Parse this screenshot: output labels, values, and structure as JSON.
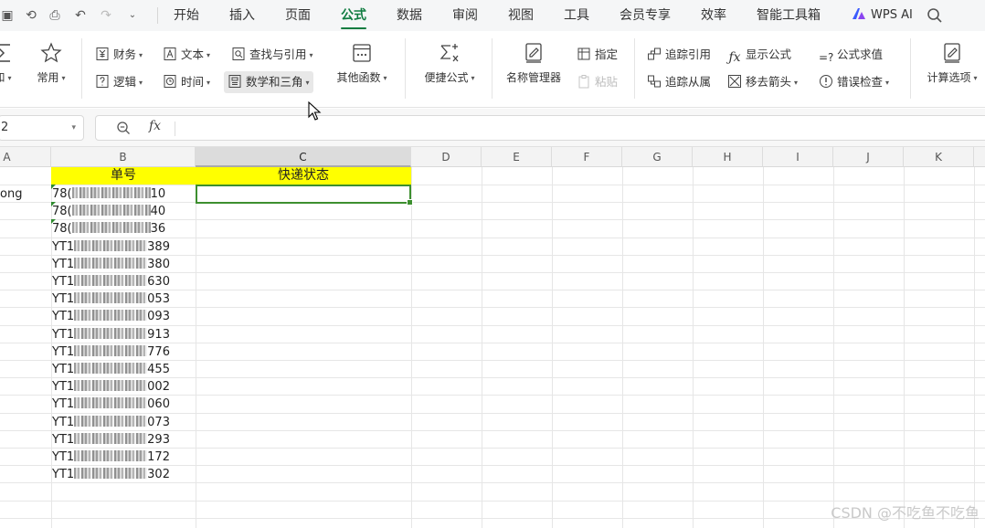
{
  "menu": {
    "tabs": [
      "开始",
      "插入",
      "页面",
      "公式",
      "数据",
      "审阅",
      "视图",
      "工具",
      "会员专享",
      "效率",
      "智能工具箱"
    ],
    "active_tab": "公式",
    "wps_ai": "WPS AI"
  },
  "ribbon": {
    "sum_label": "和",
    "common_label": "常用",
    "finance": "财务",
    "text": "文本",
    "lookup": "查找与引用",
    "logic": "逻辑",
    "time": "时间",
    "math": "数学和三角",
    "other_functions": "其他函数",
    "quick_formula": "便捷公式",
    "name_manager": "名称管理器",
    "specify": "指定",
    "paste": "粘贴",
    "trace_precedents": "追踪引用",
    "trace_dependents": "追踪从属",
    "show_formulas": "显示公式",
    "remove_arrows": "移去箭头",
    "evaluate_formula": "公式求值",
    "error_check": "错误检查",
    "calc_options": "计算选项"
  },
  "formula_bar": {
    "name_box": "2",
    "fx": "fx",
    "value": ""
  },
  "sheet": {
    "columns": [
      "A",
      "B",
      "C",
      "D",
      "E",
      "F",
      "G",
      "H",
      "I",
      "J",
      "K"
    ],
    "selected_column": "C",
    "header_b": "单号",
    "header_c": "快递状态",
    "a2_partial": "ong",
    "tracking_prefixes": [
      "78(",
      "78(",
      "78(",
      "YT1",
      "YT1",
      "YT1",
      "YT1",
      "YT1",
      "YT1",
      "YT1",
      "YT1",
      "YT1",
      "YT1",
      "YT1",
      "YT1",
      "YT1",
      "YT1"
    ],
    "tracking_suffixes": [
      "10",
      "40",
      "36",
      "389",
      "380",
      "630",
      "053",
      "093",
      "913",
      "776",
      "455",
      "002",
      "060",
      "073",
      "293",
      "172",
      "302"
    ]
  },
  "watermark": "CSDN @不吃鱼不吃鱼"
}
